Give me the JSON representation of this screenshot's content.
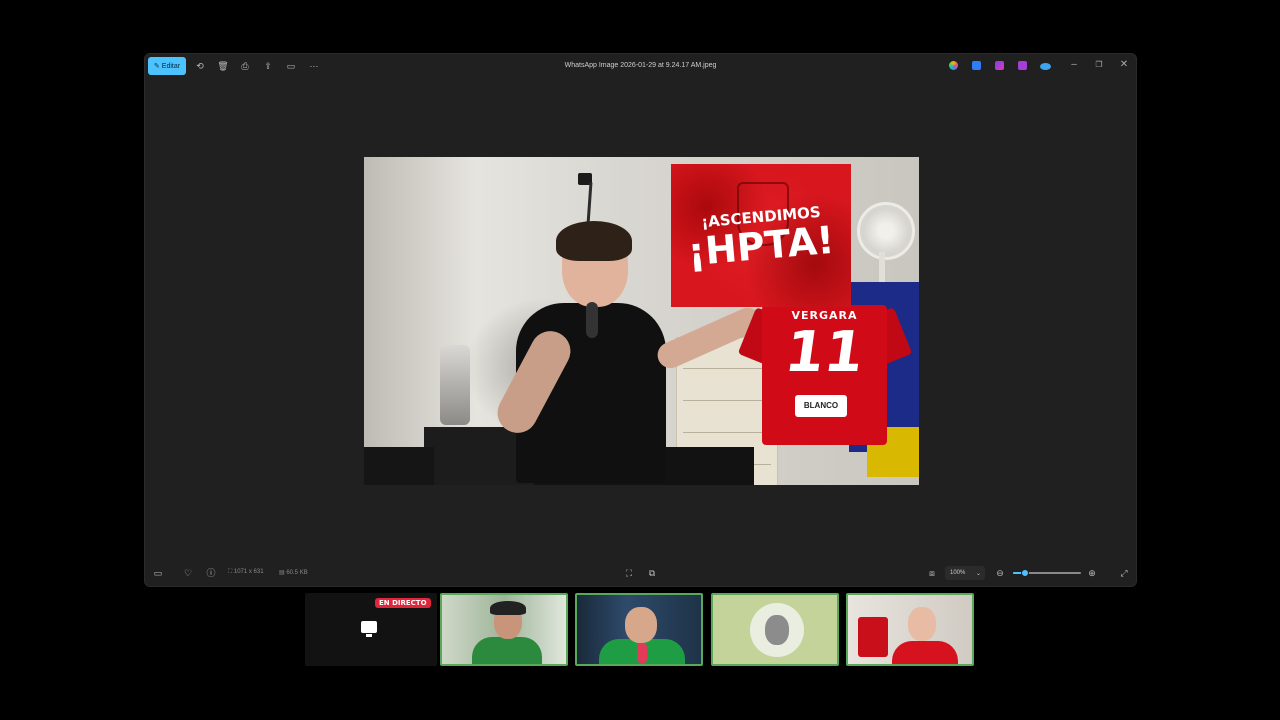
{
  "toolbar": {
    "edit_label": "Editar",
    "title": "WhatsApp Image 2026-01-29 at 9.24.17 AM.jpeg",
    "icons": [
      "rotate-icon",
      "delete-icon",
      "print-icon",
      "share-icon",
      "slideshow-icon",
      "more-icon"
    ]
  },
  "title_bar": {
    "app_icons": [
      "copilot-icon",
      "designer-icon",
      "clipchamp-icon",
      "onenote-icon",
      "onedrive-icon"
    ],
    "controls": [
      "minimize",
      "maximize",
      "close"
    ]
  },
  "photo": {
    "banner_line1": "¡ASCENDIMOS",
    "banner_line2": "¡HPTA!",
    "jersey_name": "VERGARA",
    "jersey_number": "11",
    "jersey_sponsor": "BLANCO"
  },
  "status_bar": {
    "dimensions": "1071 x 631",
    "file_size": "60.5 KB",
    "zoom_value": "100%",
    "zoom_fraction": 0.18
  },
  "stream": {
    "live_badge": "EN DIRECTO",
    "tiles": [
      "screen-share",
      "participant-1",
      "participant-2",
      "participant-3",
      "participant-4"
    ]
  },
  "colors": {
    "accent": "#4cc2ff",
    "live": "#e0263b",
    "active_border": "#5aa85a",
    "window_bg": "#202020"
  }
}
